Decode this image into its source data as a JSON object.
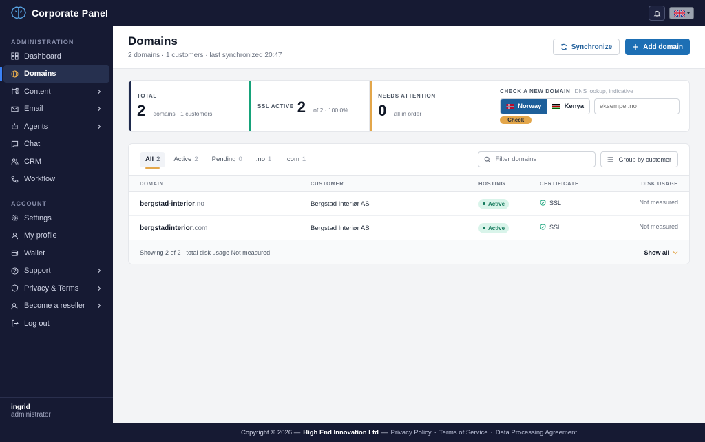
{
  "app": {
    "title": "Corporate Panel"
  },
  "sidebar": {
    "sections": {
      "admin": "ADMINISTRATION",
      "account": "ACCOUNT"
    },
    "admin_items": [
      {
        "label": "Dashboard",
        "icon": "dashboard-icon"
      },
      {
        "label": "Domains",
        "icon": "globe-icon",
        "active": true
      },
      {
        "label": "Content",
        "icon": "content-icon",
        "chevron": true
      },
      {
        "label": "Email",
        "icon": "mail-icon",
        "chevron": true
      },
      {
        "label": "Agents",
        "icon": "robot-icon",
        "chevron": true
      },
      {
        "label": "Chat",
        "icon": "chat-icon"
      },
      {
        "label": "CRM",
        "icon": "users-icon"
      },
      {
        "label": "Workflow",
        "icon": "workflow-icon"
      }
    ],
    "account_items": [
      {
        "label": "Settings",
        "icon": "gear-icon"
      },
      {
        "label": "My profile",
        "icon": "user-icon"
      },
      {
        "label": "Wallet",
        "icon": "wallet-icon"
      },
      {
        "label": "Support",
        "icon": "help-icon",
        "chevron": true
      },
      {
        "label": "Privacy & Terms",
        "icon": "shield-icon",
        "chevron": true
      },
      {
        "label": "Become a reseller",
        "icon": "reseller-icon",
        "chevron": true
      },
      {
        "label": "Log out",
        "icon": "logout-icon"
      }
    ],
    "user": {
      "name": "ingrid",
      "role": "administrator"
    }
  },
  "header": {
    "title": "Domains",
    "subtitle": "2 domains · 1 customers · last synchronized 20:47",
    "sync_label": "Synchronize",
    "add_label": "Add domain"
  },
  "stats": {
    "total": {
      "label": "TOTAL",
      "value": "2",
      "note": "· domains · 1 customers"
    },
    "ssl": {
      "label": "SSL ACTIVE",
      "value": "2",
      "note": "· of 2 · 100.0%"
    },
    "attention": {
      "label": "NEEDS ATTENTION",
      "value": "0",
      "note": "· all in order"
    }
  },
  "check": {
    "title": "CHECK A NEW DOMAIN",
    "hint": "DNS lookup, indicative",
    "countries": [
      {
        "label": "Norway",
        "selected": true
      },
      {
        "label": "Kenya",
        "selected": false
      }
    ],
    "placeholder": "eksempel.no",
    "button": "Check"
  },
  "table": {
    "tabs": [
      {
        "label": "All",
        "count": "2",
        "active": true
      },
      {
        "label": "Active",
        "count": "2"
      },
      {
        "label": "Pending",
        "count": "0"
      },
      {
        "label": ".no",
        "count": "1"
      },
      {
        "label": ".com",
        "count": "1"
      }
    ],
    "filter_placeholder": "Filter domains",
    "group_label": "Group by customer",
    "columns": {
      "domain": "DOMAIN",
      "customer": "CUSTOMER",
      "hosting": "HOSTING",
      "certificate": "CERTIFICATE",
      "disk": "DISK USAGE"
    },
    "rows": [
      {
        "name": "bergstad-interior",
        "tld": ".no",
        "customer": "Bergstad Interiør AS",
        "hosting": "Active",
        "cert": "SSL",
        "disk": "Not measured"
      },
      {
        "name": "bergstadinterior",
        "tld": ".com",
        "customer": "Bergstad Interiør AS",
        "hosting": "Active",
        "cert": "SSL",
        "disk": "Not measured"
      }
    ],
    "footer_text": "Showing 2 of 2 · total disk usage Not measured",
    "show_all": "Show all"
  },
  "footer": {
    "copyright": "Copyright © 2026 —",
    "company": "High End Innovation Ltd",
    "sep": "—",
    "links": [
      "Privacy Policy",
      "Terms of Service",
      "Data Processing Agreement"
    ]
  },
  "colors": {
    "sidebar_bg": "#161a33",
    "primary": "#1d6fb4",
    "success": "#16a37a",
    "warning": "#e3a64a"
  }
}
